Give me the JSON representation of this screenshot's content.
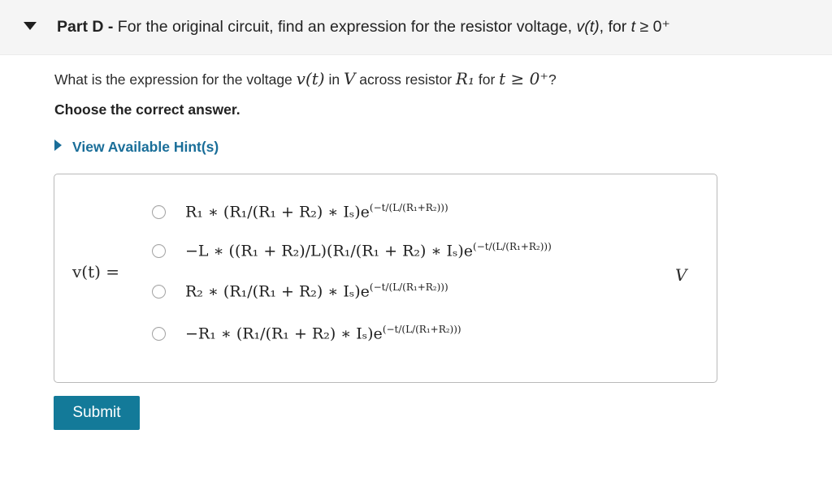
{
  "header": {
    "part_label": "Part D",
    "separator": " - ",
    "title_prefix": "For the original circuit, find an expression for the resistor voltage, ",
    "title_var": "v(t)",
    "title_middle": ", for ",
    "title_t": "t",
    "title_cond": " ≥ 0⁺"
  },
  "question": {
    "prefix": "What is the expression for the voltage ",
    "var": "v(t)",
    "in": " in ",
    "unit": "V",
    "across": " across resistor ",
    "resistor": "R₁",
    "for": " for ",
    "cond": "t ≥ 0⁺",
    "end": "?"
  },
  "instruction": "Choose the correct answer.",
  "hint_link": "View Available Hint(s)",
  "answer": {
    "lhs": "v(t) =",
    "unit": "V",
    "options": [
      {
        "formula": "R₁ ∗ (R₁/(R₁ + R₂) ∗ Iₛ)e",
        "exponent": "(−t/(L/(R₁+R₂)))",
        "selected": false
      },
      {
        "formula": "−L ∗ ((R₁ + R₂)/L)(R₁/(R₁ + R₂) ∗ Iₛ)e",
        "exponent": "(−t/(L/(R₁+R₂)))",
        "selected": false
      },
      {
        "formula": "R₂ ∗ (R₁/(R₁ + R₂) ∗ Iₛ)e",
        "exponent": "(−t/(L/(R₁+R₂)))",
        "selected": false
      },
      {
        "formula": "−R₁ ∗ (R₁/(R₁ + R₂) ∗ Iₛ)e",
        "exponent": "(−t/(L/(R₁+R₂)))",
        "selected": false
      }
    ]
  },
  "submit_label": "Submit",
  "colors": {
    "link": "#1a6e99",
    "submit_bg": "#137a99",
    "header_bg": "#f5f5f5"
  }
}
